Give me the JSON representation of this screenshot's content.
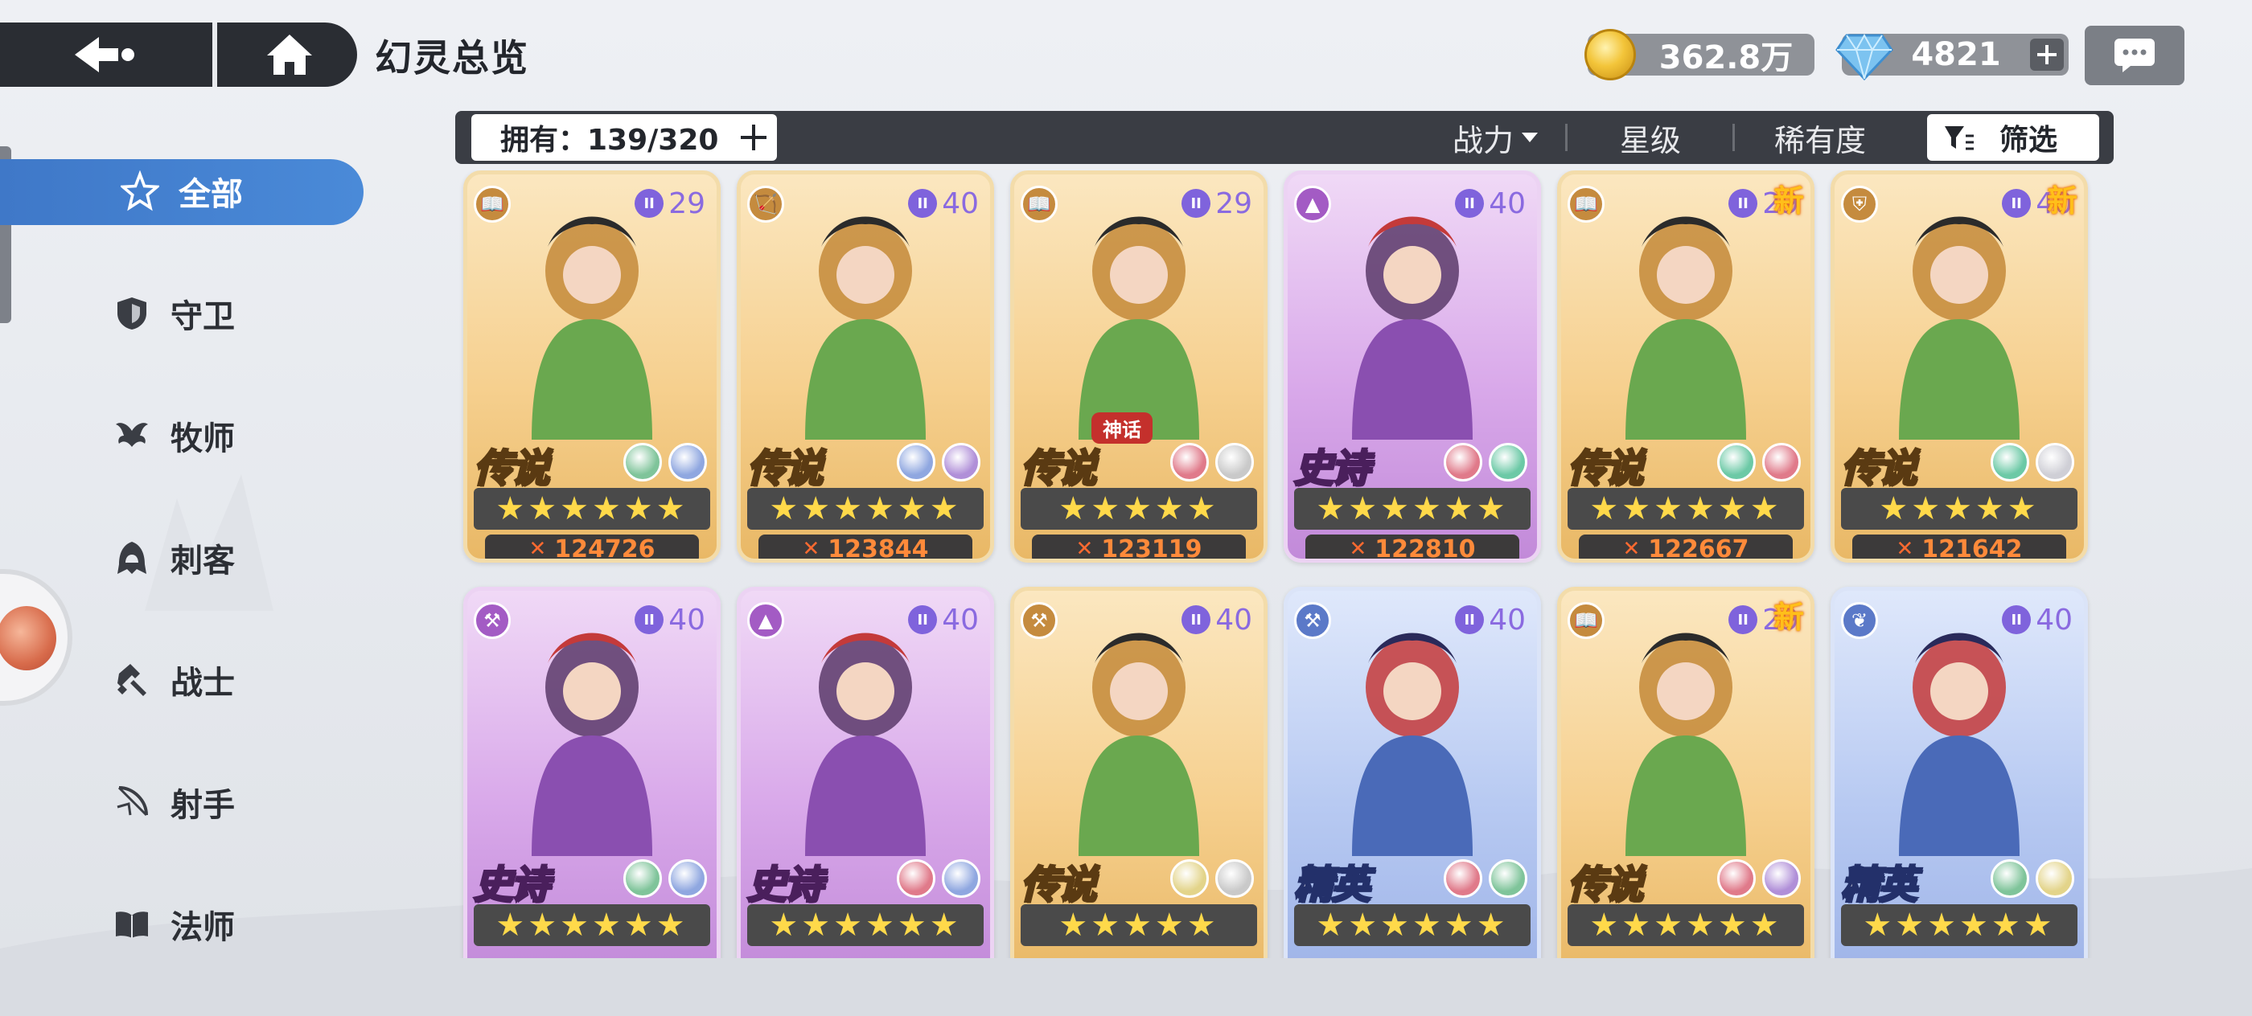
{
  "header": {
    "title": "幻灵总览",
    "gold": "362.8万",
    "gems": "4821"
  },
  "sidebar": {
    "items": [
      {
        "label": "全部",
        "icon": "star-all-icon",
        "active": true
      },
      {
        "label": "守卫",
        "icon": "shield-icon",
        "active": false
      },
      {
        "label": "牧师",
        "icon": "wings-icon",
        "active": false
      },
      {
        "label": "刺客",
        "icon": "hood-icon",
        "active": false
      },
      {
        "label": "战士",
        "icon": "hammer-icon",
        "active": false
      },
      {
        "label": "射手",
        "icon": "bow-icon",
        "active": false
      },
      {
        "label": "法师",
        "icon": "book-icon",
        "active": false
      }
    ]
  },
  "toolbar": {
    "owned": "拥有：139/320",
    "sort_power": "战力",
    "sort_star": "星级",
    "sort_rarity": "稀有度",
    "filter": "筛选"
  },
  "cards": [
    {
      "theme": "gold",
      "rarity": "传说",
      "level": "29",
      "power": "124726",
      "stars": "★★★★★★",
      "new": "",
      "myth": "",
      "elements": [
        "#7fc49a",
        "#8fa7e0"
      ],
      "class_icon": "book-icon"
    },
    {
      "theme": "gold",
      "rarity": "传说",
      "level": "40",
      "power": "123844",
      "stars": "★★★★★★",
      "new": "",
      "myth": "",
      "elements": [
        "#8fa7e0",
        "#b08fd8"
      ],
      "class_icon": "bow-icon"
    },
    {
      "theme": "gold",
      "rarity": "传说",
      "level": "29",
      "power": "123119",
      "stars": "★★★★★",
      "new": "",
      "myth": "神话",
      "elements": [
        "#e07a8a",
        "#c9c9c9"
      ],
      "class_icon": "book-icon"
    },
    {
      "theme": "purple",
      "rarity": "史诗",
      "level": "40",
      "power": "122810",
      "stars": "★★★★★★",
      "new": "",
      "myth": "",
      "elements": [
        "#e07a8a",
        "#6cc9a6"
      ],
      "class_icon": "hood-icon"
    },
    {
      "theme": "gold",
      "rarity": "传说",
      "level": "29",
      "power": "122667",
      "stars": "★★★★★★",
      "new": "新",
      "myth": "",
      "elements": [
        "#6cc9a6",
        "#e07a8a"
      ],
      "class_icon": "book-icon"
    },
    {
      "theme": "gold",
      "rarity": "传说",
      "level": "40",
      "power": "121642",
      "stars": "★★★★★",
      "new": "新",
      "myth": "",
      "elements": [
        "#6cc9a6",
        "#cfcfd6"
      ],
      "class_icon": "shield-icon"
    },
    {
      "theme": "purple",
      "rarity": "史诗",
      "level": "40",
      "power": "",
      "stars": "★★★★★★",
      "new": "",
      "myth": "",
      "elements": [
        "#7fc49a",
        "#8fa7e0"
      ],
      "class_icon": "hammer-icon"
    },
    {
      "theme": "purple",
      "rarity": "史诗",
      "level": "40",
      "power": "",
      "stars": "★★★★★★",
      "new": "",
      "myth": "",
      "elements": [
        "#e07a8a",
        "#8fa7e0"
      ],
      "class_icon": "hood-icon"
    },
    {
      "theme": "gold",
      "rarity": "传说",
      "level": "40",
      "power": "",
      "stars": "★★★★★",
      "new": "",
      "myth": "",
      "elements": [
        "#e3d48a",
        "#c9c9c9"
      ],
      "class_icon": "hammer-icon"
    },
    {
      "theme": "blue",
      "rarity": "精英",
      "level": "40",
      "power": "",
      "stars": "★★★★★★",
      "new": "",
      "myth": "",
      "elements": [
        "#e07a8a",
        "#7fc49a"
      ],
      "class_icon": "hammer-icon"
    },
    {
      "theme": "gold",
      "rarity": "传说",
      "level": "29",
      "power": "",
      "stars": "★★★★★★",
      "new": "新",
      "myth": "",
      "elements": [
        "#e07a8a",
        "#b08fd8"
      ],
      "class_icon": "book-icon"
    },
    {
      "theme": "blue",
      "rarity": "精英",
      "level": "40",
      "power": "",
      "stars": "★★★★★★",
      "new": "",
      "myth": "",
      "elements": [
        "#7fc49a",
        "#e3d48a"
      ],
      "class_icon": "wings-icon"
    }
  ],
  "colors": {
    "accent": "#4a8ad8",
    "dark_bar": "#2a2d33",
    "power_text": "#ff8a3a",
    "level_text": "#8a6ae0"
  }
}
